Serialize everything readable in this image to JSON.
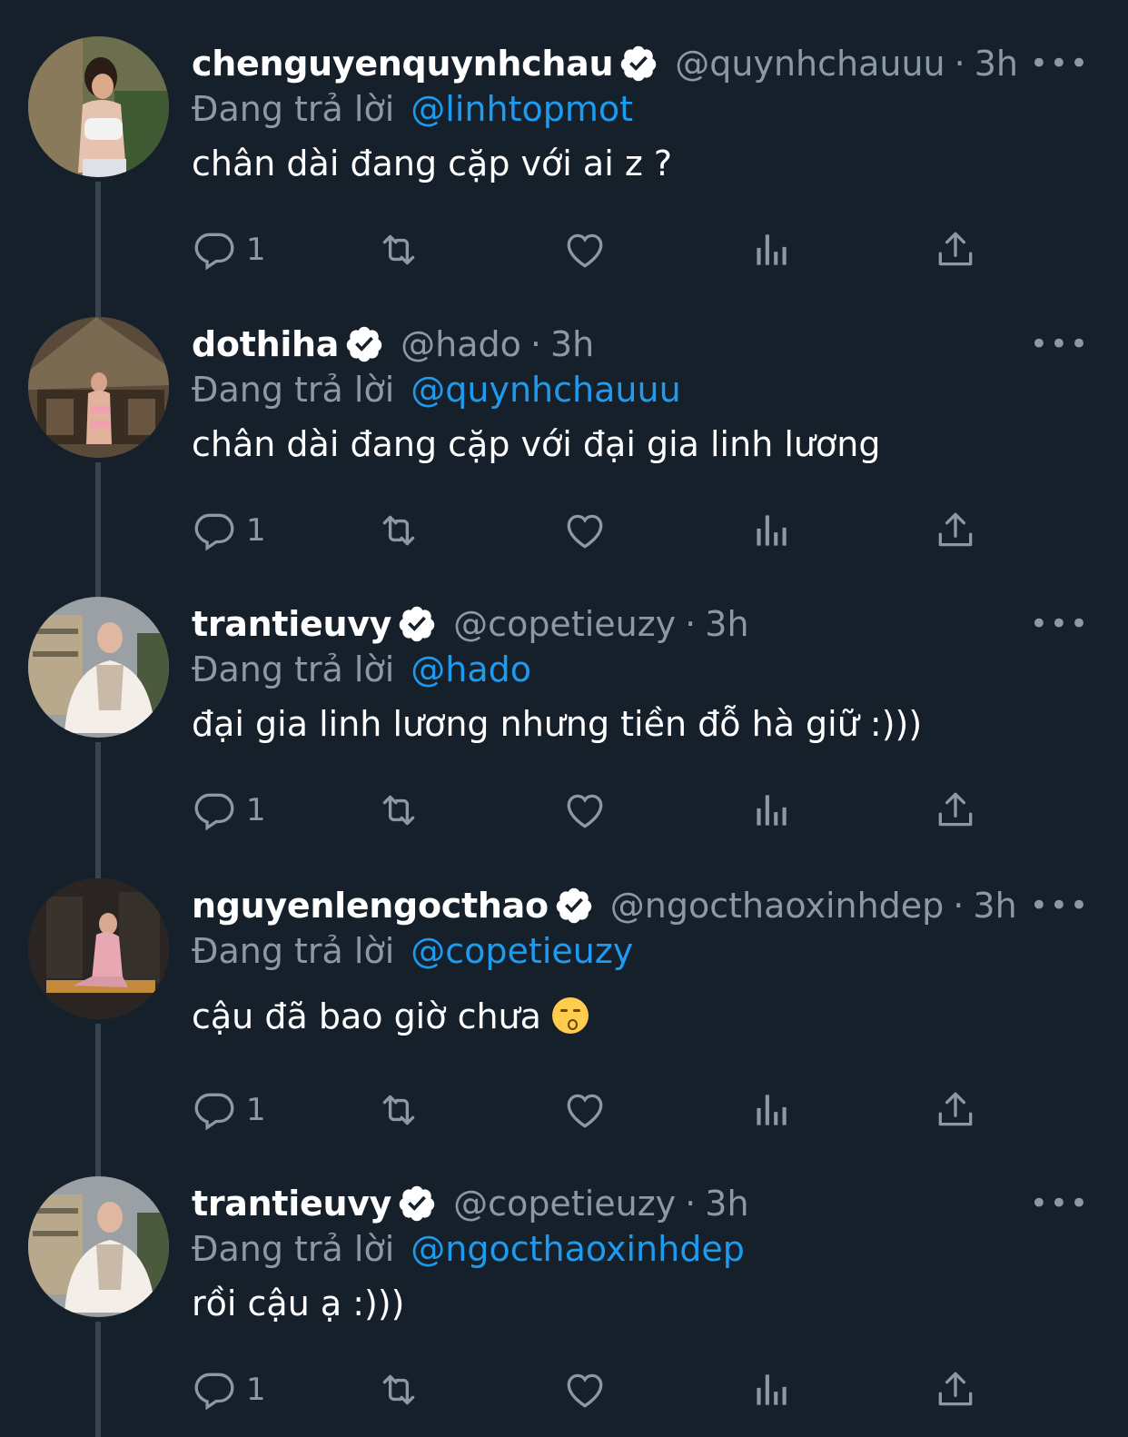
{
  "colors": {
    "background": "#15202b",
    "secondary_text": "#8b98a5",
    "mention": "#1d9bf0",
    "thread_line": "#38444d"
  },
  "icons": [
    "verified-badge-icon",
    "more-icon",
    "reply-icon",
    "retweet-icon",
    "like-icon",
    "views-icon",
    "share-icon"
  ],
  "tweets": [
    {
      "name": "chenguyenquynhchau",
      "handle": "@quynhchauuu",
      "sep": "·",
      "time": "3h",
      "more": "•••",
      "reply_prefix": "Đang trả lời",
      "reply_to": "@linhtopmot",
      "text": "chân dài đang cặp với ai z ?",
      "reply_count": "1"
    },
    {
      "name": "dothiha",
      "handle": "@hado",
      "sep": "·",
      "time": "3h",
      "more": "•••",
      "reply_prefix": "Đang trả lời",
      "reply_to": "@quynhchauuu",
      "text": "chân dài đang cặp với đại gia linh lương",
      "reply_count": "1"
    },
    {
      "name": "trantieuvy",
      "handle": "@copetieuzy",
      "sep": "·",
      "time": "3h",
      "more": "•••",
      "reply_prefix": "Đang trả lời",
      "reply_to": "@hado",
      "text": "đại gia linh lương nhưng tiền đỗ hà giữ :)))",
      "reply_count": "1"
    },
    {
      "name": "nguyenlengocthao",
      "handle": "@ngocthaoxinhdep",
      "sep": "·",
      "time": "3h",
      "more": "•••",
      "reply_prefix": "Đang trả lời",
      "reply_to": "@copetieuzy",
      "text": "cậu đã bao giờ chưa",
      "emoji": "kissing-face-icon",
      "reply_count": "1"
    },
    {
      "name": "trantieuvy",
      "handle": "@copetieuzy",
      "sep": "·",
      "time": "3h",
      "more": "•••",
      "reply_prefix": "Đang trả lời",
      "reply_to": "@ngocthaoxinhdep",
      "text": "rồi cậu ạ :)))",
      "reply_count": "1"
    }
  ]
}
